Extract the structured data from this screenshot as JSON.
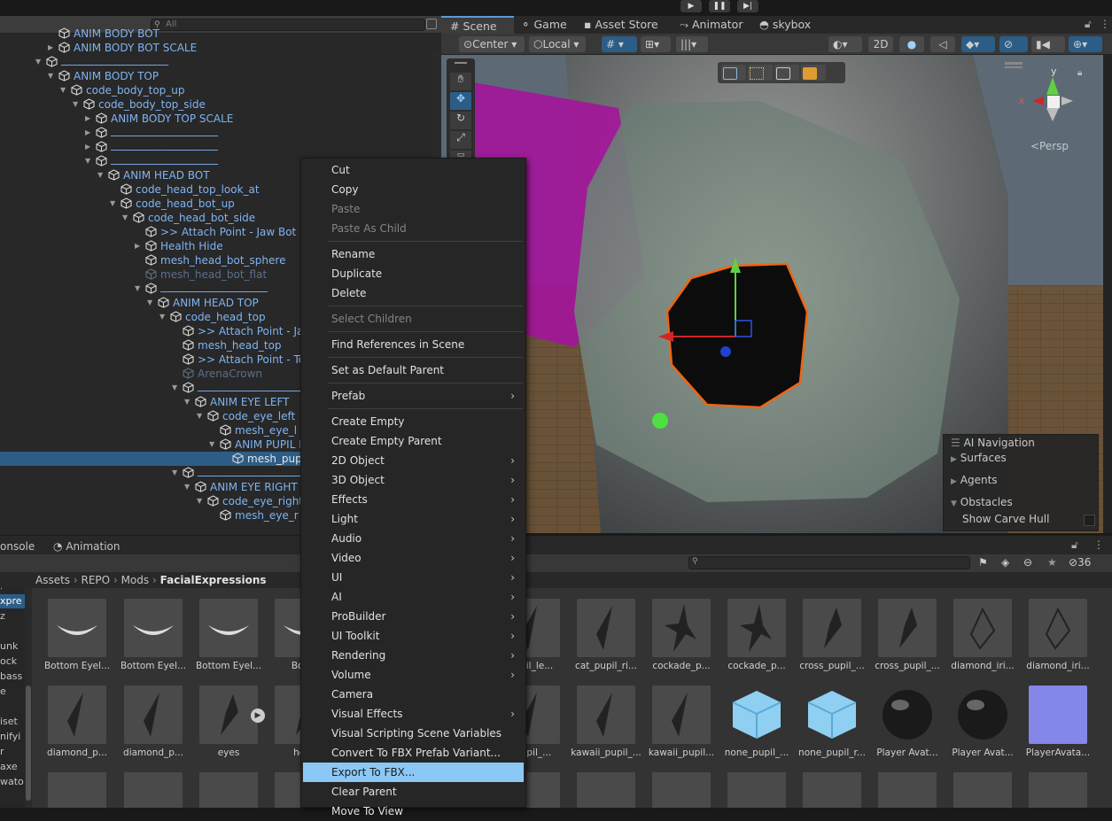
{
  "hierarchy": {
    "search_placeholder": "All",
    "rows": [
      {
        "text": "ANIM BODY BOT",
        "indent": 3,
        "arrow": "none",
        "kind": "cutoff"
      },
      {
        "text": "ANIM BODY BOT SCALE",
        "indent": 3,
        "arrow": "right"
      },
      {
        "text": "________________________",
        "indent": 2,
        "arrow": "down",
        "kind": "line"
      },
      {
        "text": "ANIM BODY TOP",
        "indent": 3,
        "arrow": "down"
      },
      {
        "text": "code_body_top_up",
        "indent": 4,
        "arrow": "down"
      },
      {
        "text": "code_body_top_side",
        "indent": 5,
        "arrow": "down"
      },
      {
        "text": "ANIM BODY TOP SCALE",
        "indent": 6,
        "arrow": "right"
      },
      {
        "text": "________________________",
        "indent": 6,
        "arrow": "right",
        "kind": "line"
      },
      {
        "text": "________________________",
        "indent": 6,
        "arrow": "right",
        "kind": "line"
      },
      {
        "text": "________________________",
        "indent": 6,
        "arrow": "down",
        "kind": "line"
      },
      {
        "text": "ANIM HEAD BOT",
        "indent": 7,
        "arrow": "down"
      },
      {
        "text": "code_head_top_look_at",
        "indent": 8,
        "arrow": "none"
      },
      {
        "text": "code_head_bot_up",
        "indent": 8,
        "arrow": "down"
      },
      {
        "text": "code_head_bot_side",
        "indent": 9,
        "arrow": "down"
      },
      {
        "text": ">> Attach Point - Jaw Bot",
        "indent": 10,
        "arrow": "none"
      },
      {
        "text": "Health Hide",
        "indent": 10,
        "arrow": "right"
      },
      {
        "text": "mesh_head_bot_sphere",
        "indent": 10,
        "arrow": "none"
      },
      {
        "text": "mesh_head_bot_flat",
        "indent": 10,
        "arrow": "none",
        "kind": "dim"
      },
      {
        "text": "________________________",
        "indent": 10,
        "arrow": "down",
        "kind": "line"
      },
      {
        "text": "ANIM HEAD TOP",
        "indent": 11,
        "arrow": "down"
      },
      {
        "text": "code_head_top",
        "indent": 12,
        "arrow": "down"
      },
      {
        "text": ">> Attach Point - Jaw Top",
        "indent": 13,
        "arrow": "none"
      },
      {
        "text": "mesh_head_top",
        "indent": 13,
        "arrow": "none"
      },
      {
        "text": ">> Attach Point - Top",
        "indent": 13,
        "arrow": "none"
      },
      {
        "text": "ArenaCrown",
        "indent": 13,
        "arrow": "none",
        "kind": "dim"
      },
      {
        "text": "________________________",
        "indent": 13,
        "arrow": "down",
        "kind": "line"
      },
      {
        "text": "ANIM EYE LEFT",
        "indent": 14,
        "arrow": "down"
      },
      {
        "text": "code_eye_left",
        "indent": 15,
        "arrow": "down"
      },
      {
        "text": "mesh_eye_l",
        "indent": 16,
        "arrow": "none"
      },
      {
        "text": "ANIM PUPIL LEFT",
        "indent": 16,
        "arrow": "down"
      },
      {
        "text": "mesh_pupil_left",
        "indent": 17,
        "arrow": "none",
        "kind": "selected"
      },
      {
        "text": "________________________",
        "indent": 13,
        "arrow": "down",
        "kind": "line"
      },
      {
        "text": "ANIM EYE RIGHT",
        "indent": 14,
        "arrow": "down"
      },
      {
        "text": "code_eye_right",
        "indent": 15,
        "arrow": "down"
      },
      {
        "text": "mesh_eye_r",
        "indent": 16,
        "arrow": "none"
      }
    ]
  },
  "scene": {
    "tabs": [
      "Scene",
      "Game",
      "Asset Store",
      "Animator",
      "skybox"
    ],
    "pivot": "Center",
    "space": "Local",
    "mode2d": "2D",
    "persp": "<Persp",
    "gizmo_x": "x",
    "gizmo_y": "y",
    "ai_nav": {
      "title": "AI Navigation",
      "items": [
        "Surfaces",
        "Agents",
        "Obstacles"
      ],
      "show_carve": "Show Carve Hull"
    }
  },
  "bottom": {
    "tabs": [
      "onsole",
      "Animation"
    ],
    "hidden_count": "36",
    "breadcrumb": [
      "Assets",
      "REPO",
      "Mods",
      "FacialExpressions"
    ],
    "left_items": [
      "r",
      "xpre",
      "z",
      "",
      "unk",
      "ock",
      "bass",
      "e",
      "",
      "iset",
      "nifyi",
      "r",
      "axe",
      "wato"
    ],
    "assets_row1": [
      "Bottom Eyel...",
      "Bottom Eyel...",
      "Bottom Eyel...",
      "Botto",
      "",
      "pupil_le...",
      "cat_pupil_ri...",
      "cockade_p...",
      "cockade_p...",
      "cross_pupil_...",
      "cross_pupil_...",
      "diamond_iri...",
      "diamond_iri..."
    ],
    "assets_row2": [
      "diamond_p...",
      "diamond_p...",
      "eyes",
      "hear",
      "",
      "_pupil_...",
      "kawaii_pupil_...",
      "kawaii_pupil...",
      "none_pupil_...",
      "none_pupil_r...",
      "Player Avat...",
      "Player Avat...",
      "PlayerAvata..."
    ]
  },
  "context_menu": {
    "items": [
      {
        "label": "Cut"
      },
      {
        "label": "Copy"
      },
      {
        "label": "Paste",
        "disabled": true
      },
      {
        "label": "Paste As Child",
        "disabled": true
      },
      {
        "sep": true
      },
      {
        "label": "Rename"
      },
      {
        "label": "Duplicate"
      },
      {
        "label": "Delete"
      },
      {
        "sep": true
      },
      {
        "label": "Select Children",
        "disabled": true
      },
      {
        "sep": true
      },
      {
        "label": "Find References in Scene"
      },
      {
        "sep": true
      },
      {
        "label": "Set as Default Parent"
      },
      {
        "sep": true
      },
      {
        "label": "Prefab",
        "sub": true
      },
      {
        "sep": true
      },
      {
        "label": "Create Empty"
      },
      {
        "label": "Create Empty Parent"
      },
      {
        "label": "2D Object",
        "sub": true
      },
      {
        "label": "3D Object",
        "sub": true
      },
      {
        "label": "Effects",
        "sub": true
      },
      {
        "label": "Light",
        "sub": true
      },
      {
        "label": "Audio",
        "sub": true
      },
      {
        "label": "Video",
        "sub": true
      },
      {
        "label": "UI",
        "sub": true
      },
      {
        "label": "AI",
        "sub": true
      },
      {
        "label": "ProBuilder",
        "sub": true
      },
      {
        "label": "UI Toolkit",
        "sub": true
      },
      {
        "label": "Rendering",
        "sub": true
      },
      {
        "label": "Volume",
        "sub": true
      },
      {
        "label": "Camera"
      },
      {
        "label": "Visual Effects",
        "sub": true
      },
      {
        "label": "Visual Scripting Scene Variables"
      },
      {
        "label": "Convert To FBX Prefab Variant..."
      },
      {
        "label": "Export To FBX...",
        "highlighted": true
      },
      {
        "label": "Clear Parent"
      },
      {
        "label": "Move To View"
      }
    ]
  },
  "colors": {
    "accent": "#8cc8f5",
    "selection": "#2c5d87",
    "prefab_text": "#7fb4f2"
  }
}
